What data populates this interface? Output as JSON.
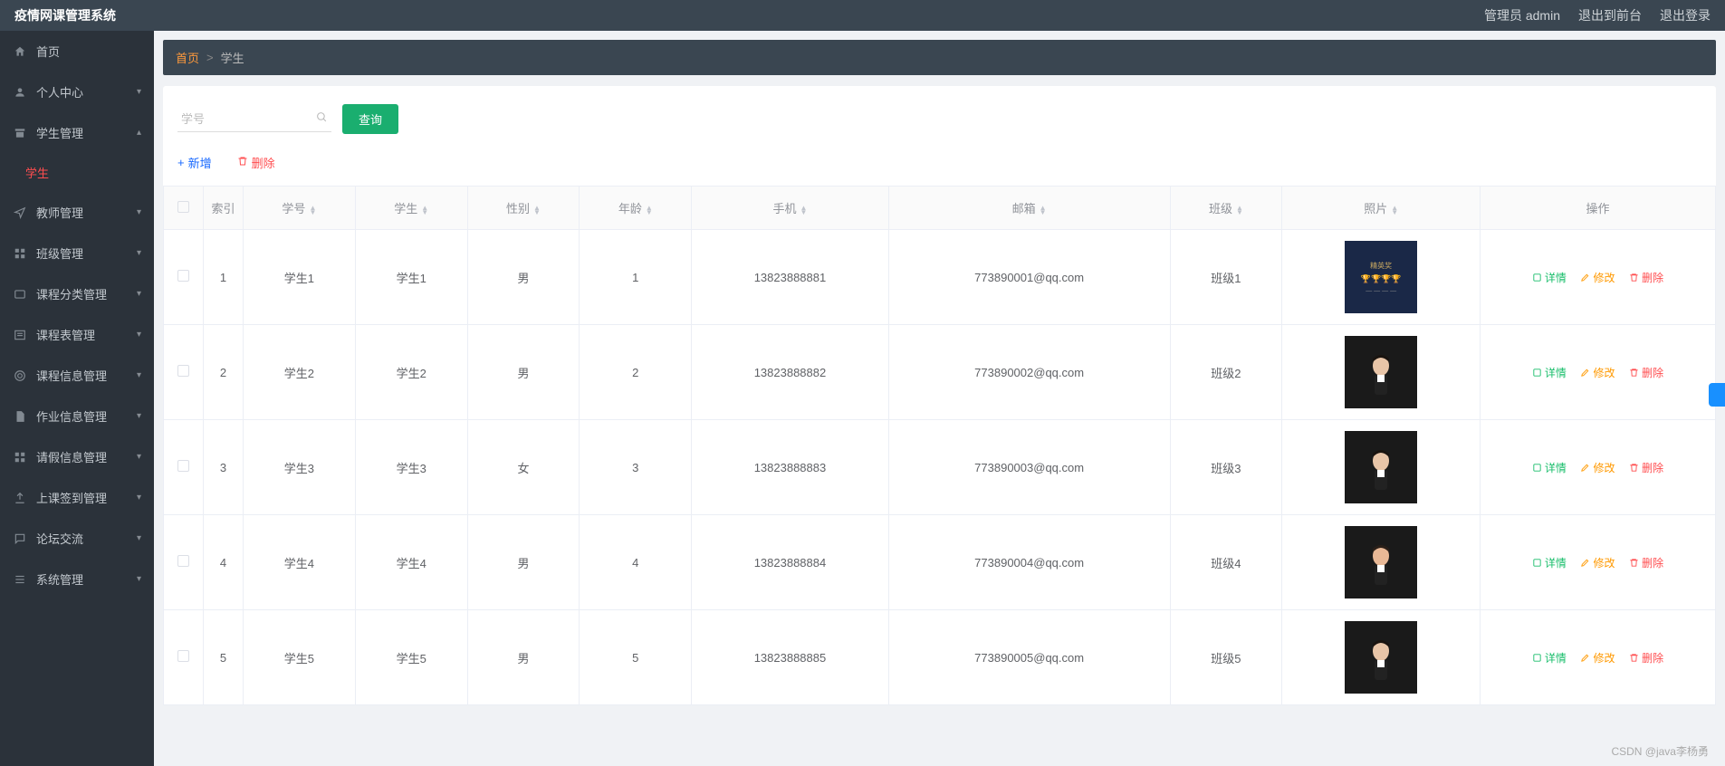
{
  "header": {
    "title": "疫情网课管理系统",
    "user_label": "管理员 admin",
    "front_label": "退出到前台",
    "logout_label": "退出登录"
  },
  "sidebar": {
    "items": [
      {
        "icon": "home",
        "label": "首页",
        "arrow": ""
      },
      {
        "icon": "user",
        "label": "个人中心",
        "arrow": "▾"
      },
      {
        "icon": "archive",
        "label": "学生管理",
        "arrow": "▴"
      },
      {
        "icon": "send",
        "label": "教师管理",
        "arrow": "▾"
      },
      {
        "icon": "grid",
        "label": "班级管理",
        "arrow": "▾"
      },
      {
        "icon": "message",
        "label": "课程分类管理",
        "arrow": "▾"
      },
      {
        "icon": "list",
        "label": "课程表管理",
        "arrow": "▾"
      },
      {
        "icon": "target",
        "label": "课程信息管理",
        "arrow": "▾"
      },
      {
        "icon": "file",
        "label": "作业信息管理",
        "arrow": "▾"
      },
      {
        "icon": "grid2",
        "label": "请假信息管理",
        "arrow": "▾"
      },
      {
        "icon": "upload",
        "label": "上课签到管理",
        "arrow": "▾"
      },
      {
        "icon": "chat",
        "label": "论坛交流",
        "arrow": "▾"
      },
      {
        "icon": "menu",
        "label": "系统管理",
        "arrow": "▾"
      }
    ],
    "sub_active": "学生"
  },
  "breadcrumb": {
    "home": "首页",
    "sep": ">",
    "current": "学生"
  },
  "search": {
    "placeholder": "学号",
    "query_btn": "查询"
  },
  "toolbar": {
    "add": "新增",
    "delete": "删除",
    "add_icon": "+",
    "del_icon": "🗑"
  },
  "table": {
    "headers": [
      "",
      "索引",
      "学号",
      "学生",
      "性别",
      "年龄",
      "手机",
      "邮箱",
      "班级",
      "照片",
      "操作"
    ],
    "rows": [
      {
        "idx": "1",
        "sno": "学生1",
        "name": "学生1",
        "gender": "男",
        "age": "1",
        "phone": "13823888881",
        "email": "773890001@qq.com",
        "class": "班级1",
        "photo": "award"
      },
      {
        "idx": "2",
        "sno": "学生2",
        "name": "学生2",
        "gender": "男",
        "age": "2",
        "phone": "13823888882",
        "email": "773890002@qq.com",
        "class": "班级2",
        "photo": "male"
      },
      {
        "idx": "3",
        "sno": "学生3",
        "name": "学生3",
        "gender": "女",
        "age": "3",
        "phone": "13823888883",
        "email": "773890003@qq.com",
        "class": "班级3",
        "photo": "female1"
      },
      {
        "idx": "4",
        "sno": "学生4",
        "name": "学生4",
        "gender": "男",
        "age": "4",
        "phone": "13823888884",
        "email": "773890004@qq.com",
        "class": "班级4",
        "photo": "female2"
      },
      {
        "idx": "5",
        "sno": "学生5",
        "name": "学生5",
        "gender": "男",
        "age": "5",
        "phone": "13823888885",
        "email": "773890005@qq.com",
        "class": "班级5",
        "photo": "male"
      }
    ],
    "actions": {
      "view": "详情",
      "edit": "修改",
      "delete": "删除"
    }
  },
  "watermark": "CSDN @java李杨勇"
}
